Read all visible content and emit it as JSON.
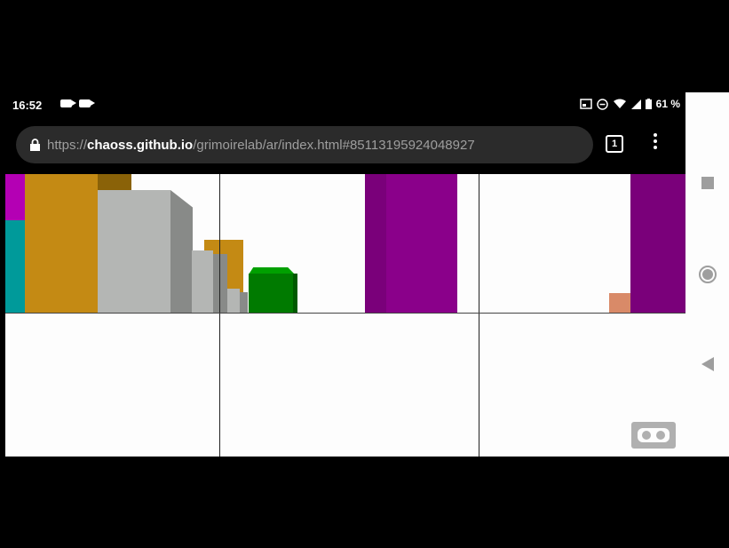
{
  "status_bar": {
    "time": "16:52",
    "battery": "61 %",
    "icons": [
      "video-camera-icon",
      "video-camera-icon",
      "cast-icon",
      "do-not-disturb-icon",
      "wifi-icon",
      "signal-icon",
      "battery-icon"
    ]
  },
  "browser": {
    "url_scheme": "https://",
    "url_host": "chaoss.github.io",
    "url_path": "/grimoirelab/ar/index.html#85113195924048927",
    "tab_count": "1",
    "icons": [
      "lock-icon",
      "tabs-icon",
      "more-vert-icon"
    ]
  },
  "scene": {
    "colors": {
      "magenta": "#b400b4",
      "teal": "#009a9a",
      "gold": "#c48a14",
      "gray": "#b4b6b4",
      "green": "#007a00",
      "purple": "#8a008a",
      "salmon": "#d98a68",
      "grid": "#222222"
    },
    "vr_button_icon": "cardboard-vr-icon"
  },
  "nav_bar": {
    "icons": [
      "recents-square-icon",
      "home-circle-icon",
      "back-triangle-icon"
    ]
  }
}
